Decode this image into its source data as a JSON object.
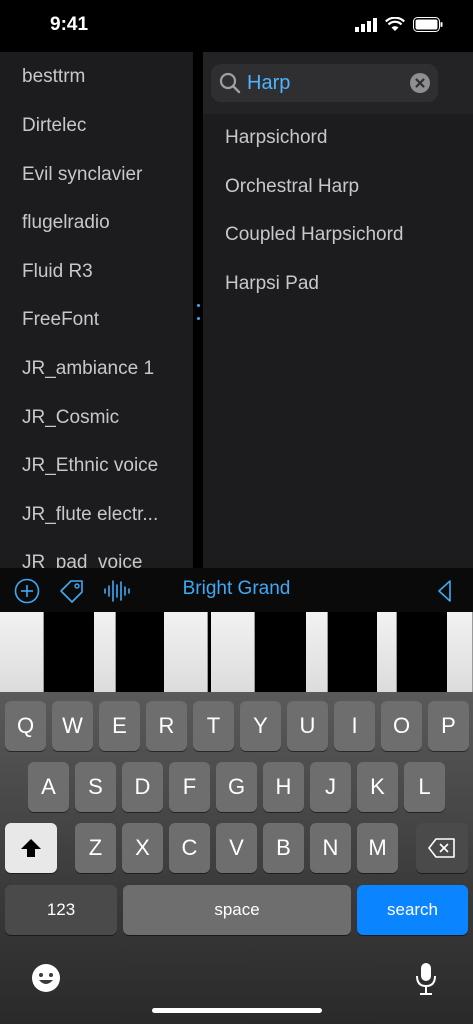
{
  "status_bar": {
    "time": "9:41"
  },
  "left_list": {
    "items": [
      "besttrm",
      "Dirtelec",
      "Evil synclavier",
      "flugelradio",
      "Fluid R3",
      "FreeFont",
      "JR_ambiance 1",
      "JR_Cosmic",
      "JR_Ethnic voice",
      "JR_flute electr...",
      "JR_pad_voice"
    ]
  },
  "search": {
    "value": "Harp"
  },
  "results": {
    "items": [
      "Harpsichord",
      "Orchestral Harp",
      "Coupled Harpsichord",
      "Harpsi Pad"
    ]
  },
  "toolbar": {
    "preset_name": "Bright Grand",
    "icons": [
      "add-circle-icon",
      "tag-icon",
      "waveform-icon",
      "collapse-triangle-icon"
    ],
    "accent": "#3fa9f5"
  },
  "keyboard": {
    "row1": [
      "Q",
      "W",
      "E",
      "R",
      "T",
      "Y",
      "U",
      "I",
      "O",
      "P"
    ],
    "row2": [
      "A",
      "S",
      "D",
      "F",
      "G",
      "H",
      "J",
      "K",
      "L"
    ],
    "row3": [
      "Z",
      "X",
      "C",
      "V",
      "B",
      "N",
      "M"
    ],
    "numbers_label": "123",
    "space_label": "space",
    "search_label": "search"
  }
}
